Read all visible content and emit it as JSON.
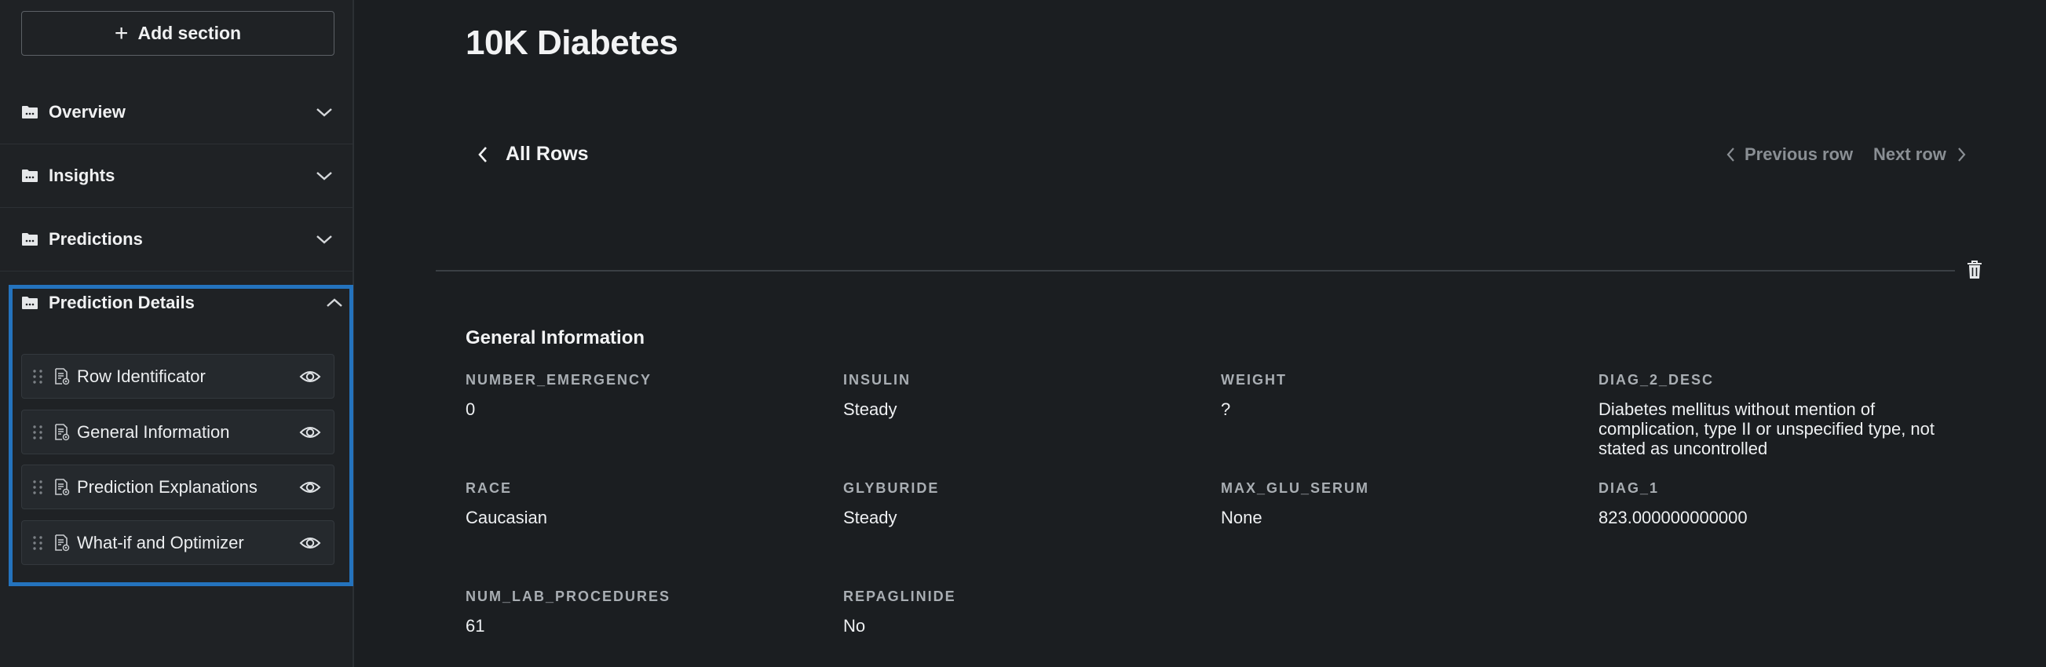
{
  "sidebar": {
    "add_section_label": "Add section",
    "sections": [
      {
        "label": "Overview"
      },
      {
        "label": "Insights"
      },
      {
        "label": "Predictions"
      }
    ],
    "prediction_details": {
      "label": "Prediction Details",
      "items": [
        {
          "label": "Row Identificator"
        },
        {
          "label": "General Information"
        },
        {
          "label": "Prediction Explanations"
        },
        {
          "label": "What-if and Optimizer"
        }
      ]
    },
    "highlight_color": "#2473bd"
  },
  "main": {
    "title": "10K Diabetes",
    "back_label": "All Rows",
    "prev_label": "Previous row",
    "next_label": "Next row",
    "section_title": "General Information",
    "fields": [
      {
        "key": "NUMBER_EMERGENCY",
        "value": "0"
      },
      {
        "key": "INSULIN",
        "value": "Steady"
      },
      {
        "key": "WEIGHT",
        "value": "?"
      },
      {
        "key": "DIAG_2_DESC",
        "value": "Diabetes mellitus without mention of complication, type II or unspecified type, not stated as uncontrolled"
      },
      {
        "key": "RACE",
        "value": "Caucasian"
      },
      {
        "key": "GLYBURIDE",
        "value": "Steady"
      },
      {
        "key": "MAX_GLU_SERUM",
        "value": "None"
      },
      {
        "key": "DIAG_1",
        "value": "823.000000000000"
      },
      {
        "key": "NUM_LAB_PROCEDURES",
        "value": "61"
      },
      {
        "key": "REPAGLINIDE",
        "value": "No"
      }
    ]
  },
  "icons": {
    "folder": "folder-icon",
    "chevron_down": "chevron-down-icon",
    "chevron_up": "chevron-up-icon",
    "drag": "drag-handle-icon",
    "document": "document-icon",
    "eye": "eye-icon",
    "trash": "trash-icon"
  }
}
